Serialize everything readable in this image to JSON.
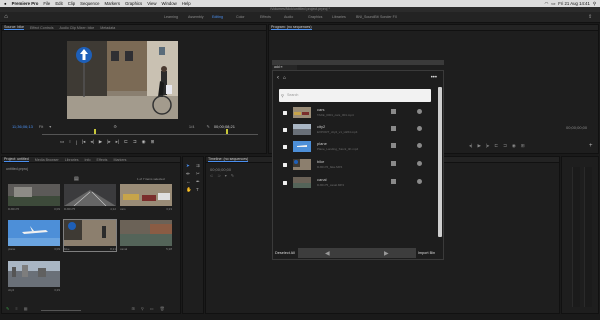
{
  "menubar": {
    "apple": "",
    "app": "Premiere Pro",
    "items": [
      "File",
      "Edit",
      "Clip",
      "Sequence",
      "Markers",
      "Graphics",
      "View",
      "Window",
      "Help"
    ],
    "datetime": "Fri 21 Aug 14:41"
  },
  "titlebar": {
    "path": "/Volumes/Nick/untitled project.prproj *"
  },
  "workspace": {
    "tabs": [
      "Learning",
      "Assembly",
      "Editing",
      "Color",
      "Effects",
      "Audio",
      "Graphics",
      "Libraries",
      "BNI_SoundBit",
      "Sonder FX"
    ],
    "active": 2
  },
  "source": {
    "tabs": [
      "Source: bike",
      "Effect Controls",
      "Audio Clip Mixer: bike",
      "Metadata"
    ],
    "timecode_in": "11;36;06;13",
    "fit": "Fit",
    "fraction": "1/4",
    "timecode_out": "00;00;08;21"
  },
  "program": {
    "tab": "Program: (no sequences)",
    "timecode": "00;00;00;00"
  },
  "project": {
    "tabs": [
      "Project: untitled",
      "Media Browser",
      "Libraries",
      "Info",
      "Effects",
      "Markers"
    ],
    "search_value": "untitled.prproj",
    "selected_text": "1 of 7 items selected",
    "clips": [
      {
        "name": "DJI0176",
        "dur": "0;09"
      },
      {
        "name": "DJI0175",
        "dur": "4;12"
      },
      {
        "name": "cars",
        "dur": "3;23"
      },
      {
        "name": "plane",
        "dur": "3;09"
      },
      {
        "name": "bike",
        "dur": "8;21"
      },
      {
        "name": "canal",
        "dur": "5;28"
      },
      {
        "name": "city2",
        "dur": "3;29"
      }
    ]
  },
  "timeline": {
    "tab": "Timeline: (no sequences)",
    "timecode": "00;00;00;00"
  },
  "overlay": {
    "small_tab": "add ≡",
    "search_placeholder": "Search",
    "items": [
      {
        "name": "cars",
        "meta": "TAKE_0001_cars_001.mp4"
      },
      {
        "name": "city2",
        "meta": "EXPORT_city2_v1_H264.mp4"
      },
      {
        "name": "plane",
        "meta": "Plane_Landing_Stock_4K.mp4"
      },
      {
        "name": "bike",
        "meta": "DJI0176_bike.MP4"
      },
      {
        "name": "canal",
        "meta": "DJI0175_canal.MP4"
      }
    ],
    "deselect": "Deselect All",
    "import": "Import Bin"
  },
  "colors": {
    "accent": "#4a8ff0",
    "panel": "#1e1e1e",
    "green": "#3ca04a"
  }
}
